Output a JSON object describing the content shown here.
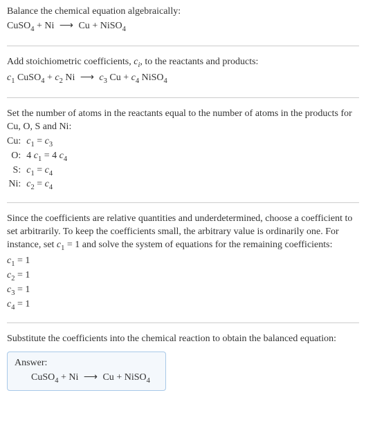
{
  "section1": {
    "line1": "Balance the chemical equation algebraically:"
  },
  "equation1": {
    "r1": "CuSO",
    "r1sub": "4",
    "plus": " + ",
    "r2": "Ni",
    "arrow": "⟶",
    "p1": "Cu",
    "p2": "NiSO",
    "p2sub": "4"
  },
  "section2": {
    "line1_a": "Add stoichiometric coefficients, ",
    "line1_ci": "c",
    "line1_ci_sub": "i",
    "line1_b": ", to the reactants and products:"
  },
  "equation2": {
    "c1": "c",
    "c1sub": "1",
    "r1": " CuSO",
    "r1sub": "4",
    "plus": " + ",
    "c2": "c",
    "c2sub": "2",
    "r2": " Ni",
    "arrow": "⟶",
    "c3": "c",
    "c3sub": "3",
    "p1": " Cu",
    "c4": "c",
    "c4sub": "4",
    "p2": " NiSO",
    "p2sub": "4"
  },
  "section3": {
    "line1": "Set the number of atoms in the reactants equal to the number of atoms in the products for Cu, O, S and Ni:",
    "rows": [
      {
        "label": "Cu:",
        "lhs_coef": "",
        "lhs_c": "c",
        "lhs_sub": "1",
        "eq": " = ",
        "rhs_coef": "",
        "rhs_c": "c",
        "rhs_sub": "3"
      },
      {
        "label": "O:",
        "lhs_coef": "4 ",
        "lhs_c": "c",
        "lhs_sub": "1",
        "eq": " = ",
        "rhs_coef": "4 ",
        "rhs_c": "c",
        "rhs_sub": "4"
      },
      {
        "label": "S:",
        "lhs_coef": "",
        "lhs_c": "c",
        "lhs_sub": "1",
        "eq": " = ",
        "rhs_coef": "",
        "rhs_c": "c",
        "rhs_sub": "4"
      },
      {
        "label": "Ni:",
        "lhs_coef": "",
        "lhs_c": "c",
        "lhs_sub": "2",
        "eq": " = ",
        "rhs_coef": "",
        "rhs_c": "c",
        "rhs_sub": "4"
      }
    ]
  },
  "section4": {
    "text_a": "Since the coefficients are relative quantities and underdetermined, choose a coefficient to set arbitrarily. To keep the coefficients small, the arbitrary value is ordinarily one. For instance, set ",
    "set_c": "c",
    "set_sub": "1",
    "set_val": " = 1",
    "text_b": " and solve the system of equations for the remaining coefficients:",
    "coefs": [
      {
        "c": "c",
        "sub": "1",
        "val": " = 1"
      },
      {
        "c": "c",
        "sub": "2",
        "val": " = 1"
      },
      {
        "c": "c",
        "sub": "3",
        "val": " = 1"
      },
      {
        "c": "c",
        "sub": "4",
        "val": " = 1"
      }
    ]
  },
  "section5": {
    "line1": "Substitute the coefficients into the chemical reaction to obtain the balanced equation:"
  },
  "answer": {
    "label": "Answer:",
    "r1": "CuSO",
    "r1sub": "4",
    "plus": " + ",
    "r2": "Ni",
    "arrow": "⟶",
    "p1": "Cu",
    "p2": "NiSO",
    "p2sub": "4"
  }
}
